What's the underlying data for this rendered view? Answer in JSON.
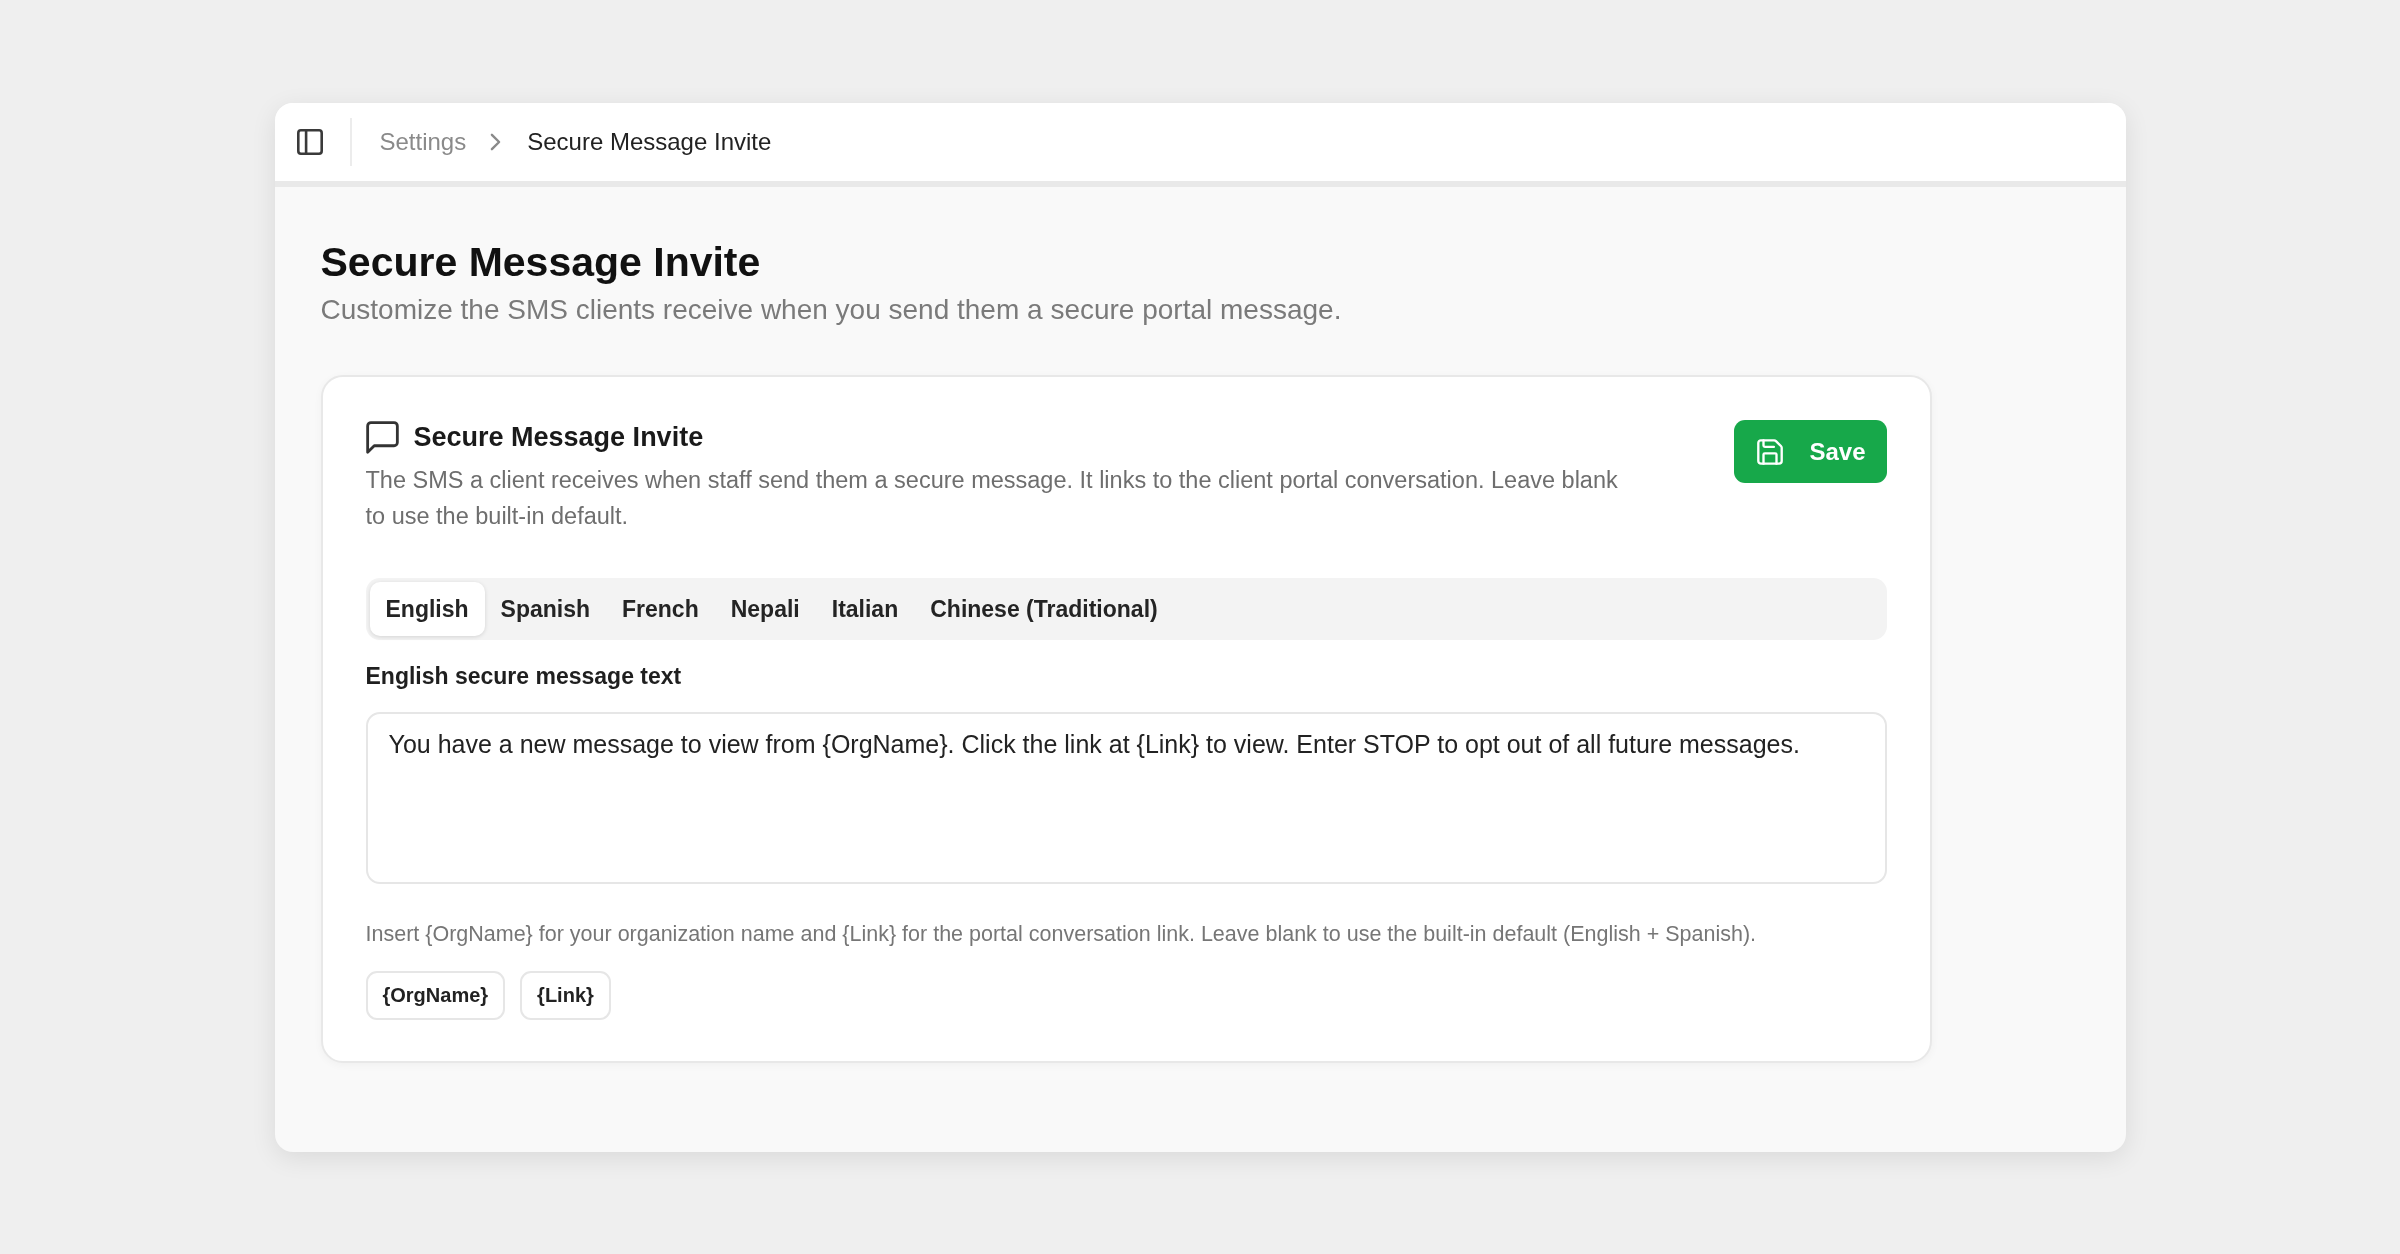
{
  "topbar": {
    "breadcrumb": [
      {
        "label": "Settings",
        "current": false
      },
      {
        "label": "Secure Message Invite",
        "current": true
      }
    ]
  },
  "page": {
    "title": "Secure Message Invite",
    "subtitle": "Customize the SMS clients receive when you send them a secure portal message."
  },
  "card": {
    "title": "Secure Message Invite",
    "description": "The SMS a client receives when staff send them a secure message. It links to the client portal conversation. Leave blank to use the built-in default.",
    "save_button": "Save",
    "tabs": [
      {
        "label": "English",
        "selected": true
      },
      {
        "label": "Spanish",
        "selected": false
      },
      {
        "label": "French",
        "selected": false
      },
      {
        "label": "Nepali",
        "selected": false
      },
      {
        "label": "Italian",
        "selected": false
      },
      {
        "label": "Chinese (Traditional)",
        "selected": false
      }
    ],
    "field": {
      "label": "English secure message text",
      "value": "You have a new message to view from {OrgName}. Click the link at {Link} to view. Enter STOP to opt out of all future messages."
    },
    "hint": "Insert {OrgName} for your organization name and {Link} for the portal conversation link. Leave blank to use the built-in default (English + Spanish).",
    "tokens": [
      "{OrgName}",
      "{Link}"
    ]
  }
}
